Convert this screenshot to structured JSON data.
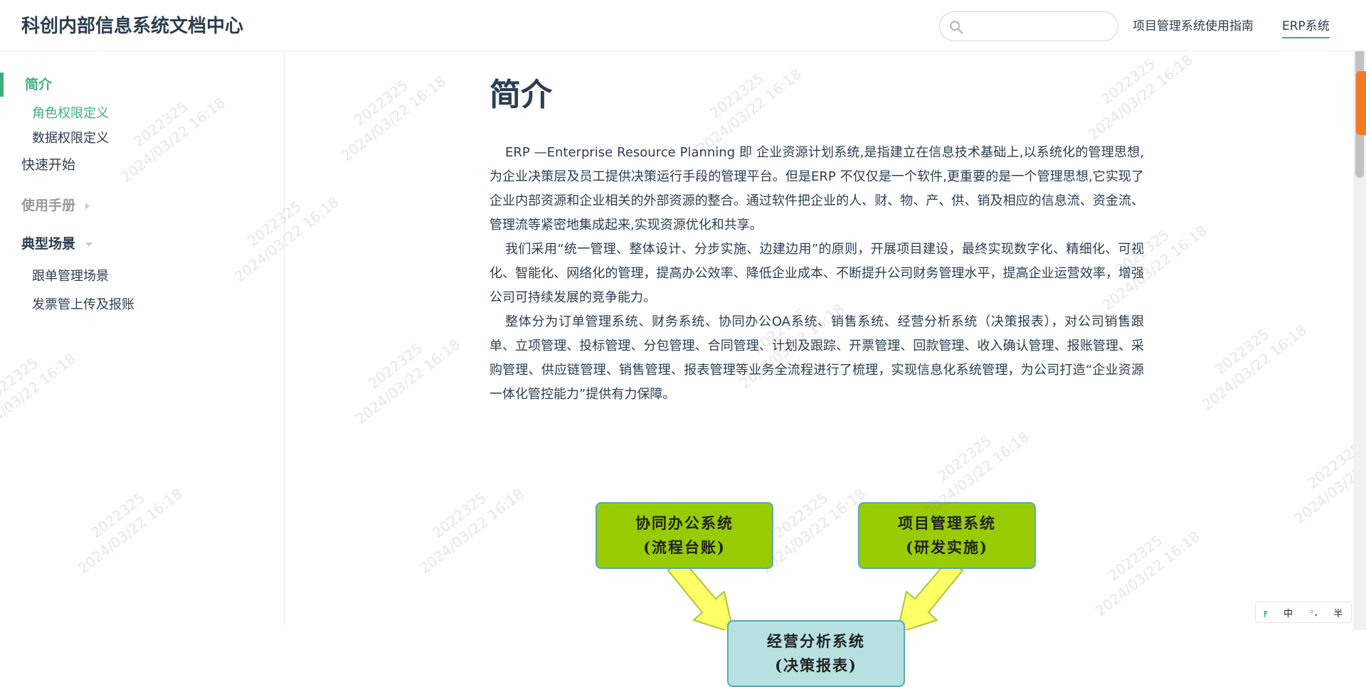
{
  "header": {
    "site_title": "科创内部信息系统文档中心",
    "search": {
      "value": "",
      "placeholder": ""
    },
    "nav": [
      {
        "label": "项目管理系统使用指南",
        "active": false
      },
      {
        "label": "ERP系统",
        "active": true
      }
    ]
  },
  "sidebar": {
    "intro": "简介",
    "intro_children": [
      "角色权限定义",
      "数据权限定义"
    ],
    "quick_start": "快速开始",
    "groups": [
      {
        "label": "使用手册",
        "expanded": false,
        "items": []
      },
      {
        "label": "典型场景",
        "expanded": true,
        "items": [
          "跟单管理场景",
          "发票管上传及报账"
        ]
      }
    ]
  },
  "main": {
    "title": "简介",
    "paragraphs": [
      "ERP —Enterprise Resource Planning 即 企业资源计划系统,是指建立在信息技术基础上,以系统化的管理思想,为企业决策层及员工提供决策运行手段的管理平台。但是ERP 不仅仅是一个软件,更重要的是一个管理思想,它实现了企业内部资源和企业相关的外部资源的整合。通过软件把企业的人、财、物、产、供、销及相应的信息流、资金流、管理流等紧密地集成起来,实现资源优化和共享。",
      "我们采用“统一管理、整体设计、分步实施、边建边用”的原则，开展项目建设，最终实现数字化、精细化、可视化、智能化、网络化的管理，提高办公效率、降低企业成本、不断提升公司财务管理水平，提高企业运营效率，增强公司可持续发展的竞争能力。",
      "整体分为订单管理系统、财务系统、协同办公OA系统、销售系统、经营分析系统（决策报表），对公司销售跟单、立项管理、投标管理、分包管理、合同管理、计划及跟踪、开票管理、回款管理、收入确认管理、报账管理、采购管理、供应链管理、销售管理、报表管理等业务全流程进行了梳理，实现信息化系统管理，为公司打造“企业资源一体化管控能力”提供有力保障。"
    ],
    "diagram": {
      "oa": {
        "line1": "协同办公系统",
        "line2": "(流程台账)"
      },
      "pm": {
        "line1": "项目管理系统",
        "line2": "(研发实施)"
      },
      "ba": {
        "line1": "经营分析系统",
        "line2": "(决策报表)"
      }
    }
  },
  "watermark": {
    "id": "2022325",
    "datetime": "2024/03/22 16:18"
  },
  "ime": {
    "mode": "中",
    "punct": "◦,",
    "width": "半"
  },
  "colors": {
    "accent": "#3eaf7c",
    "text": "#2c3e50",
    "diagram_green": "#99cc00",
    "diagram_cyan": "#b7e1e1",
    "diagram_arrow": "#ffff66"
  }
}
